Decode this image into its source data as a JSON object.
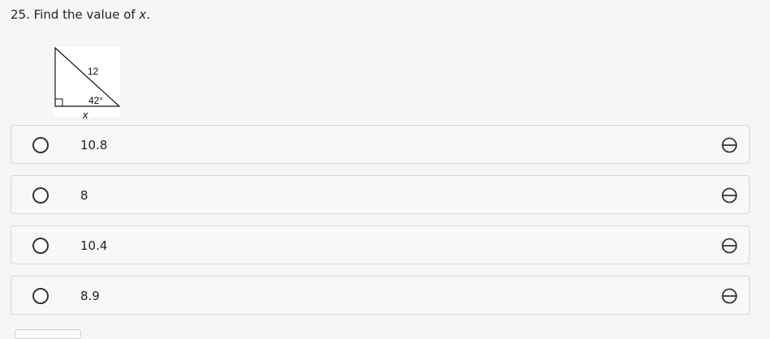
{
  "question": {
    "prefix": "25. Find the value of ",
    "variable": "x",
    "suffix": "."
  },
  "figure": {
    "hypotenuse_label": "12",
    "angle_label": "42°",
    "side_label": "x"
  },
  "options": [
    {
      "label": "10.8"
    },
    {
      "label": "8"
    },
    {
      "label": "10.4"
    },
    {
      "label": "8.9"
    }
  ],
  "icons": {
    "radio": "radio-button-icon",
    "eliminate": "strikethrough-circle-icon"
  }
}
